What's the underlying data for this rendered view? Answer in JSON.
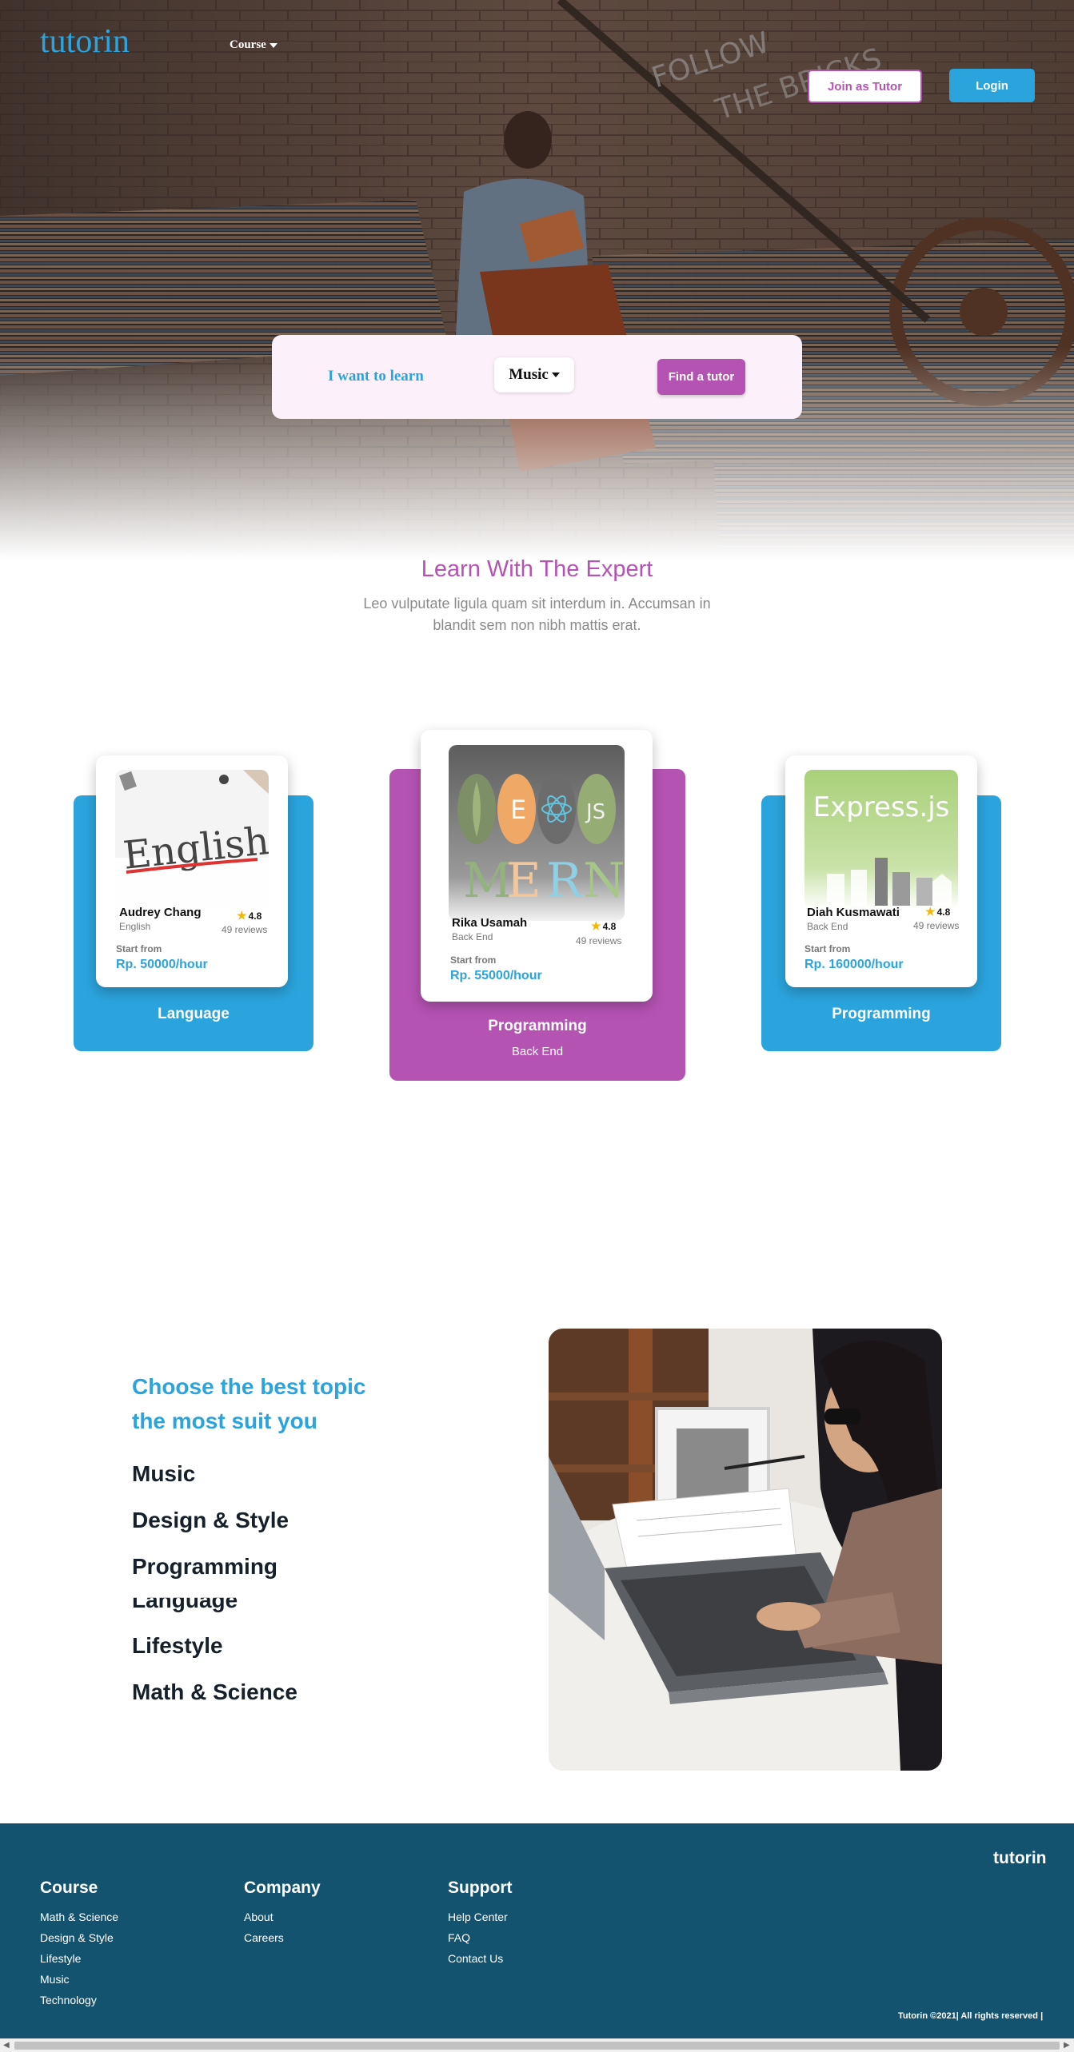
{
  "brand": "tutorin",
  "nav": {
    "course_label": "Course",
    "join_label": "Join as Tutor",
    "login_label": "Login"
  },
  "search": {
    "label": "I want to learn",
    "selected": "Music",
    "button": "Find a tutor"
  },
  "expert": {
    "title": "Learn With The Expert",
    "subtitle": "Leo vulputate ligula quam sit interdum in. Accumsan in blandit sem non nibh mattis erat."
  },
  "cards": [
    {
      "tutor": "Audrey Chang",
      "subject": "English",
      "rating": "4.8",
      "reviews": "49 reviews",
      "start_label": "Start from",
      "price": "Rp. 50000/hour",
      "category": "Language",
      "category_sub": "",
      "image_text": "English",
      "color": "#2ba4dd"
    },
    {
      "tutor": "Rika Usamah",
      "subject": "Back End",
      "rating": "4.8",
      "reviews": "49 reviews",
      "start_label": "Start from",
      "price": "Rp. 55000/hour",
      "category": "Programming",
      "category_sub": "Back End",
      "image_text": "MERN",
      "color": "#b553b3"
    },
    {
      "tutor": "Diah Kusmawati",
      "subject": "Back End",
      "rating": "4.8",
      "reviews": "49 reviews",
      "start_label": "Start from",
      "price": "Rp. 160000/hour",
      "category": "Programming",
      "category_sub": "",
      "image_text": "Express.js",
      "color": "#2ba4dd"
    }
  ],
  "topics": {
    "title": "Choose the best topic the most suit you",
    "items": [
      "Music",
      "Design & Style",
      "Programming",
      "Language",
      "Lifestyle",
      "Math & Science"
    ]
  },
  "footer": {
    "brand": "tutorin",
    "columns": [
      {
        "title": "Course",
        "links": [
          "Math & Science",
          "Design & Style",
          "Lifestyle",
          "Music",
          "Technology"
        ]
      },
      {
        "title": "Company",
        "links": [
          "About",
          "Careers"
        ]
      },
      {
        "title": "Support",
        "links": [
          "Help Center",
          "FAQ",
          "Contact Us"
        ]
      }
    ],
    "copyright": "Tutorin ©2021| All rights reserved |"
  },
  "colors": {
    "primary": "#2ba4dd",
    "accent": "#b553b3",
    "footer": "#135370"
  }
}
